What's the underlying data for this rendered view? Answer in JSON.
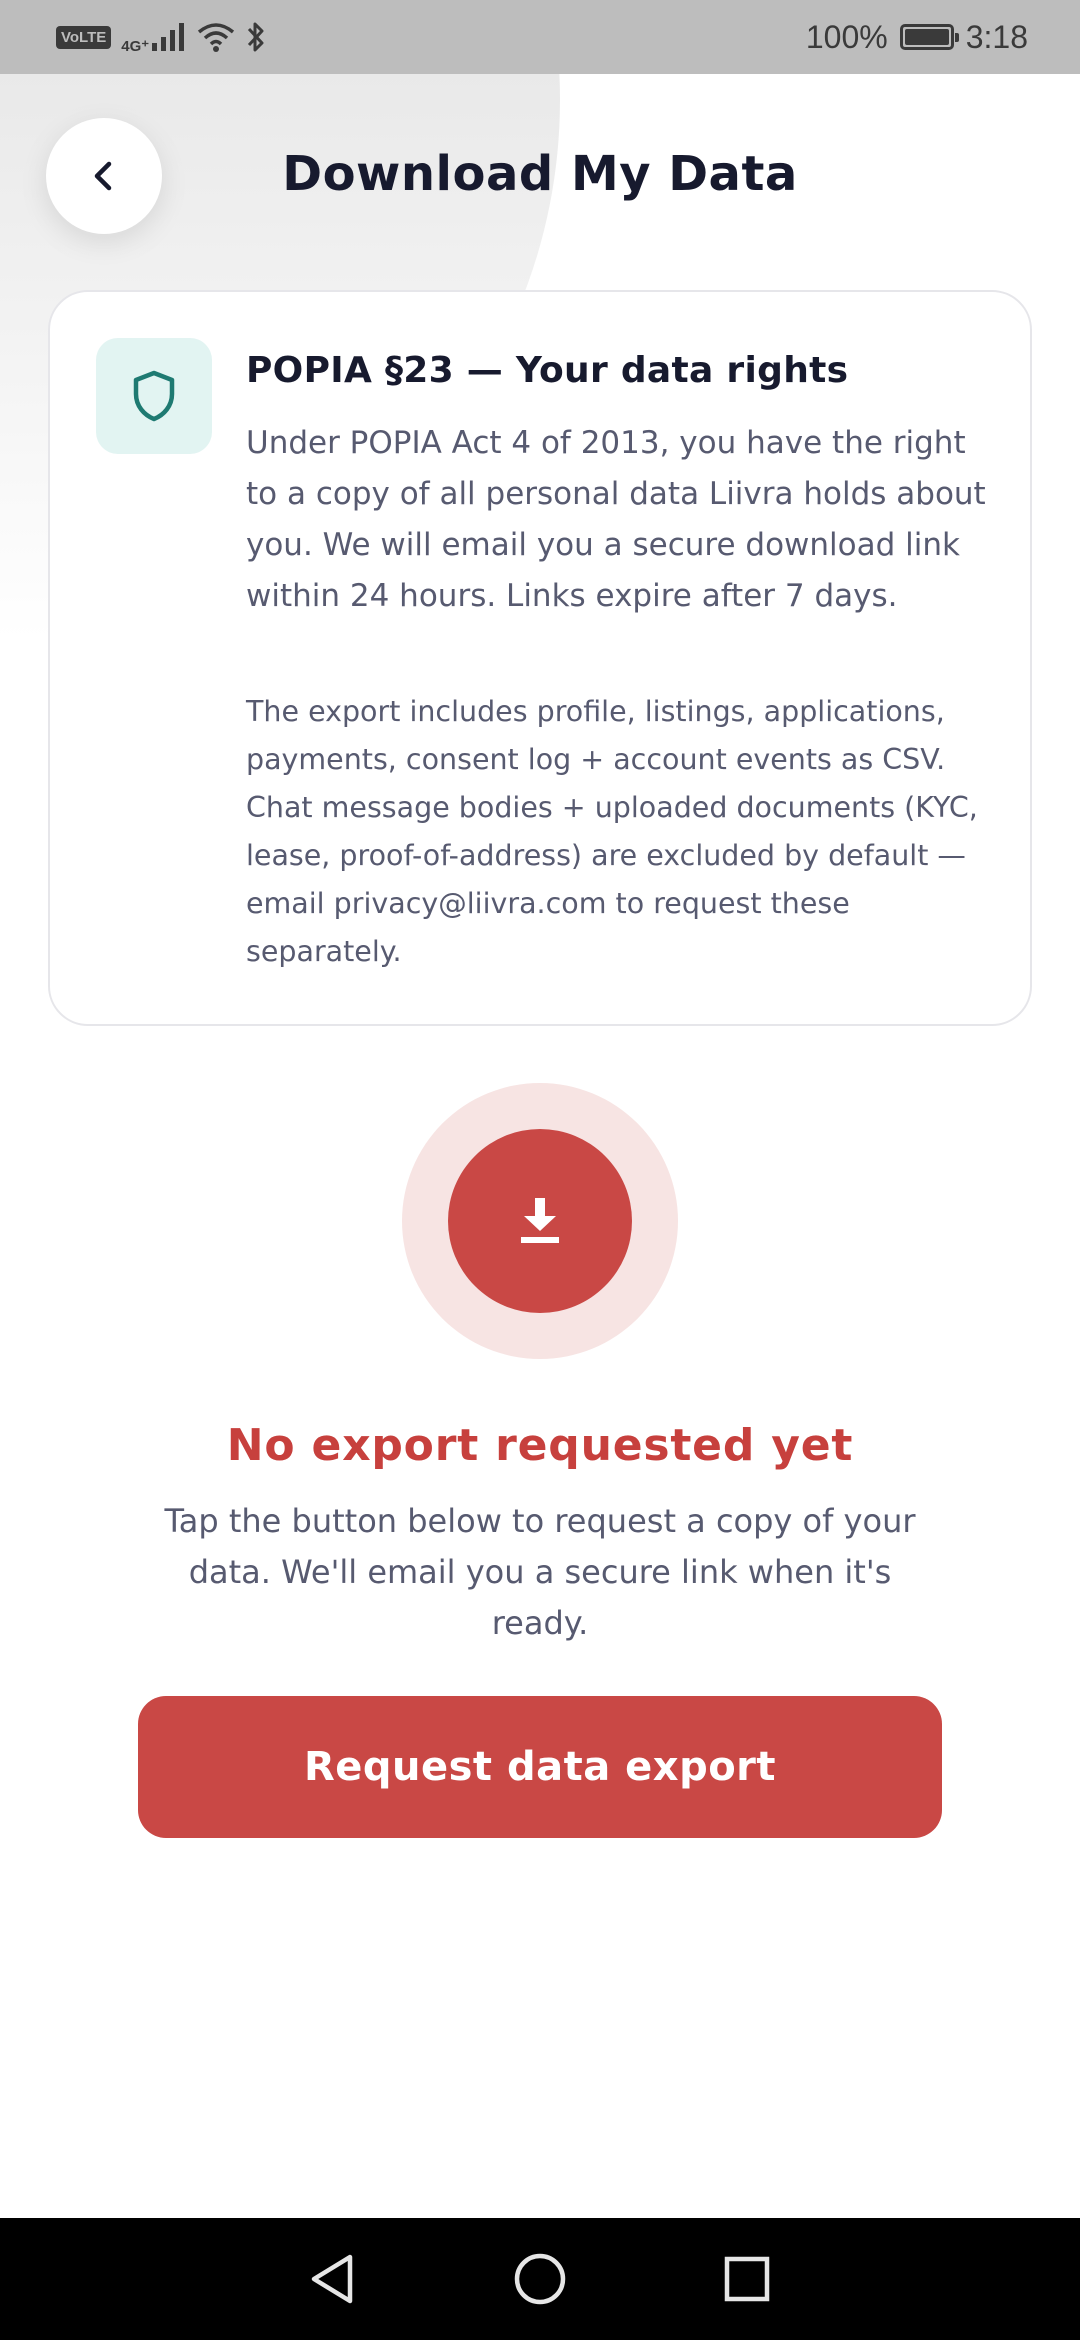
{
  "status_bar": {
    "volte": "VoLTE",
    "network": "4G⁺",
    "battery_percent": "100%",
    "time": "3:18",
    "battery_level": 1.0
  },
  "header": {
    "back_icon": "chevron-left-icon",
    "title": "Download My Data"
  },
  "info_card": {
    "icon": "shield-icon",
    "heading": "POPIA §23 — Your data rights",
    "body": "Under POPIA Act 4 of 2013, you have the right to a copy of all personal data Liivra holds about you. We will email you a secure download link within 24 hours. Links expire after 7 days.",
    "note": "The export includes profile, listings, applications, payments, consent log + account events as CSV. Chat message bodies + uploaded documents (KYC, lease, proof-of-address) are excluded by default — email privacy@liivra.com to request these separately."
  },
  "export_status": {
    "icon": "download-icon",
    "title": "No export requested yet",
    "description": "Tap the button below to request a copy of your data. We'll email you a secure link when it's ready."
  },
  "actions": {
    "request_label": "Request data export"
  },
  "nav_bar": {
    "back_icon": "triangle-back-icon",
    "home_icon": "circle-home-icon",
    "recents_icon": "square-recents-icon"
  },
  "colors": {
    "accent": "#c94845",
    "accent_soft": "#f7e4e3",
    "shield_bg": "#e2f4f2",
    "shield_stroke": "#1e7a72",
    "heading": "#171a2e",
    "body_text": "#575a70"
  }
}
